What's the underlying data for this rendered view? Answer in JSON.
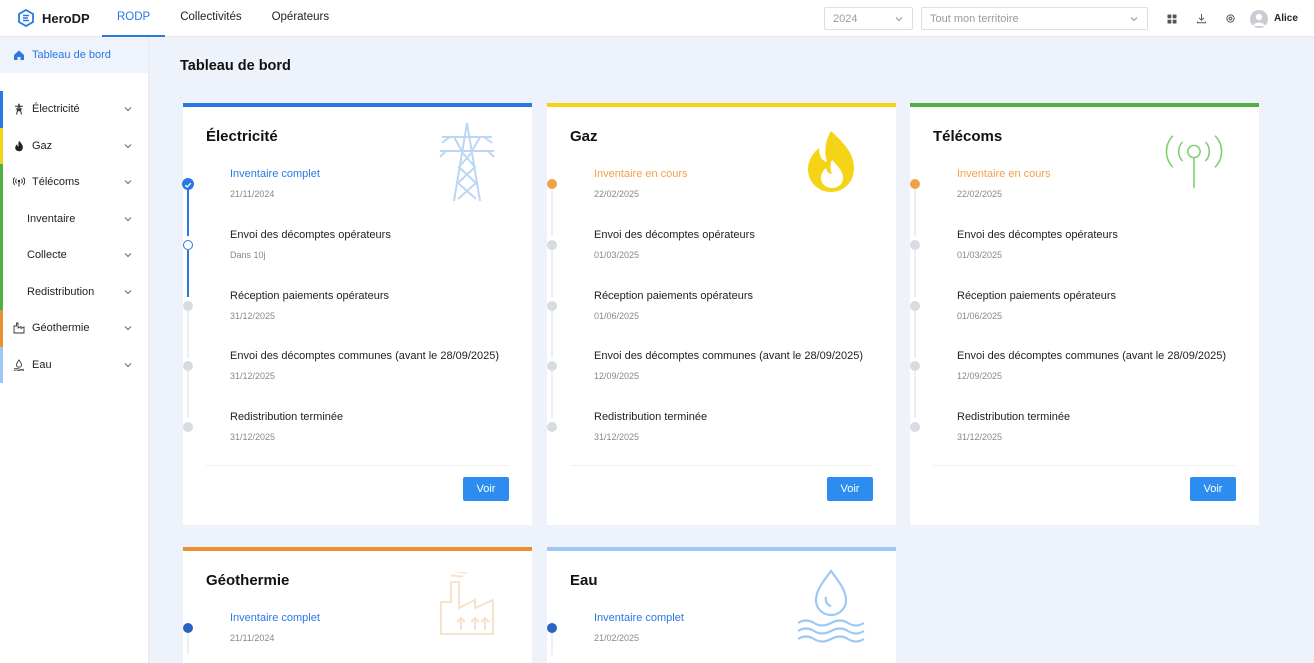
{
  "app": {
    "name": "HeroDP"
  },
  "topnav": [
    {
      "label": "RODP",
      "active": true
    },
    {
      "label": "Collectivités",
      "active": false
    },
    {
      "label": "Opérateurs",
      "active": false
    }
  ],
  "filters": {
    "year": "2024",
    "territory": "Tout mon territoire"
  },
  "user": {
    "name": "Alice"
  },
  "sidebar": {
    "home": "Tableau de bord",
    "items": [
      {
        "label": "Électricité",
        "icon": "pylon-icon",
        "color": "#2a78e4"
      },
      {
        "label": "Gaz",
        "icon": "flame-icon",
        "color": "#f5d418"
      },
      {
        "label": "Télécoms",
        "icon": "antenna-icon",
        "color": "#52b043"
      },
      {
        "label": "Inventaire",
        "sub": true
      },
      {
        "label": "Collecte",
        "sub": true
      },
      {
        "label": "Redistribution",
        "sub": true
      },
      {
        "label": "Géothermie",
        "icon": "factory-icon",
        "color": "#e8912e"
      },
      {
        "label": "Eau",
        "icon": "water-icon",
        "color": "#9cc8f5"
      }
    ]
  },
  "page": {
    "title": "Tableau de bord"
  },
  "colors": {
    "accent": "#2a78e4",
    "button": "#2d8cf0",
    "in_progress": "#f0a24a",
    "pending": "#d9dbe2"
  },
  "cards": [
    {
      "title": "Électricité",
      "color": "#2a78e4",
      "icon": "pylon-icon",
      "steps": [
        {
          "label": "Inventaire complet",
          "date": "21/11/2024",
          "status": "done"
        },
        {
          "label": "Envoi des décomptes opérateurs",
          "date": "Dans 10j",
          "status": "current"
        },
        {
          "label": "Réception paiements opérateurs",
          "date": "31/12/2025",
          "status": "pending"
        },
        {
          "label": "Envoi des décomptes communes (avant le 28/09/2025)",
          "date": "31/12/2025",
          "status": "pending"
        },
        {
          "label": "Redistribution terminée",
          "date": "31/12/2025",
          "status": "pending"
        }
      ],
      "button": "Voir"
    },
    {
      "title": "Gaz",
      "color": "#f5d418",
      "icon": "flame-icon",
      "steps": [
        {
          "label": "Inventaire en cours",
          "date": "22/02/2025",
          "status": "in_progress"
        },
        {
          "label": "Envoi des décomptes opérateurs",
          "date": "01/03/2025",
          "status": "pending"
        },
        {
          "label": "Réception paiements opérateurs",
          "date": "01/06/2025",
          "status": "pending"
        },
        {
          "label": "Envoi des décomptes communes (avant le 28/09/2025)",
          "date": "12/09/2025",
          "status": "pending"
        },
        {
          "label": "Redistribution terminée",
          "date": "31/12/2025",
          "status": "pending"
        }
      ],
      "button": "Voir"
    },
    {
      "title": "Télécoms",
      "color": "#52b043",
      "icon": "antenna-icon",
      "steps": [
        {
          "label": "Inventaire en cours",
          "date": "22/02/2025",
          "status": "in_progress"
        },
        {
          "label": "Envoi des décomptes opérateurs",
          "date": "01/03/2025",
          "status": "pending"
        },
        {
          "label": "Réception paiements opérateurs",
          "date": "01/06/2025",
          "status": "pending"
        },
        {
          "label": "Envoi des décomptes communes (avant le 28/09/2025)",
          "date": "12/09/2025",
          "status": "pending"
        },
        {
          "label": "Redistribution terminée",
          "date": "31/12/2025",
          "status": "pending"
        }
      ],
      "button": "Voir"
    },
    {
      "title": "Géothermie",
      "color": "#e8912e",
      "icon": "factory-icon",
      "steps": [
        {
          "label": "Inventaire complet",
          "date": "21/11/2024",
          "status": "complete_solid"
        }
      ]
    },
    {
      "title": "Eau",
      "color": "#9cc8f5",
      "icon": "water-icon",
      "steps": [
        {
          "label": "Inventaire complet",
          "date": "21/02/2025",
          "status": "complete_solid"
        }
      ]
    }
  ]
}
